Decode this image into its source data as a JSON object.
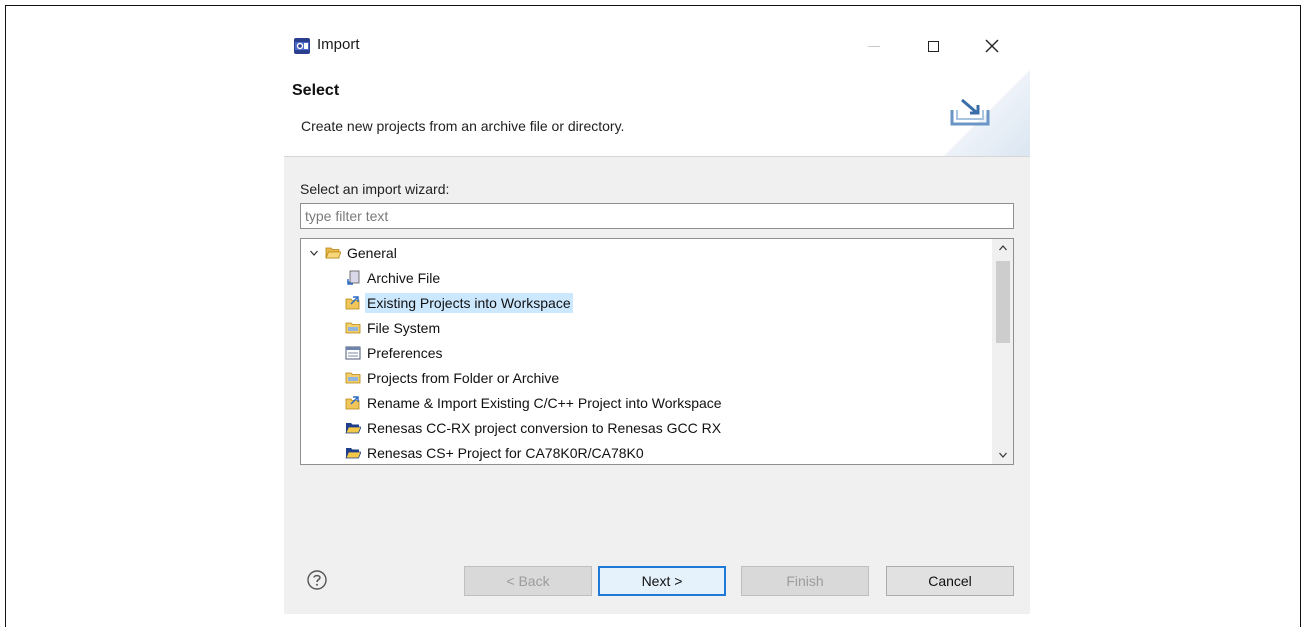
{
  "window": {
    "title": "Import"
  },
  "header": {
    "title": "Select",
    "description": "Create new projects from an archive file or directory."
  },
  "body": {
    "wizard_label": "Select an import wizard:",
    "filter": {
      "value": "",
      "placeholder": "type filter text"
    },
    "tree": {
      "group": {
        "label": "General",
        "expanded": true
      },
      "items": [
        {
          "label": "Archive File",
          "icon": "archive-file-icon",
          "selected": false
        },
        {
          "label": "Existing Projects into Workspace",
          "icon": "existing-projects-icon",
          "selected": true
        },
        {
          "label": "File System",
          "icon": "folder-icon",
          "selected": false
        },
        {
          "label": "Preferences",
          "icon": "preferences-icon",
          "selected": false
        },
        {
          "label": "Projects from Folder or Archive",
          "icon": "folder-icon",
          "selected": false
        },
        {
          "label": "Rename & Import Existing C/C++ Project into Workspace",
          "icon": "existing-projects-icon",
          "selected": false
        },
        {
          "label": "Renesas CC-RX project conversion to Renesas GCC RX",
          "icon": "open-folder-icon",
          "selected": false
        },
        {
          "label": "Renesas CS+ Project for CA78K0R/CA78K0",
          "icon": "open-folder-icon",
          "selected": false
        }
      ]
    }
  },
  "footer": {
    "back_label": "< Back",
    "next_label": "Next >",
    "finish_label": "Finish",
    "cancel_label": "Cancel"
  },
  "colors": {
    "selection": "#cce8ff",
    "default_button_border": "#1e7ad6",
    "dialog_background": "#f0f0f0"
  }
}
